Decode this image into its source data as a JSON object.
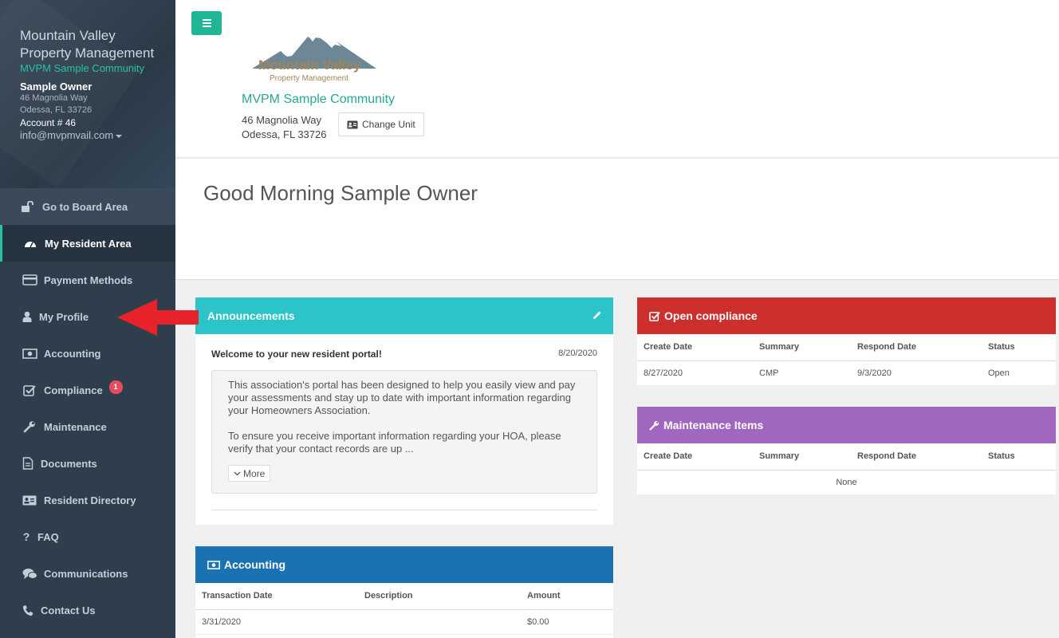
{
  "sidebar": {
    "title": "Mountain Valley Property Management",
    "community": "MVPM Sample Community",
    "owner": "Sample Owner",
    "address_line1": "46 Magnolia Way",
    "address_line2": "Odessa, FL 33726",
    "account": "Account # 46",
    "email": "info@mvpmvail.com",
    "nav": [
      {
        "label": "Go to Board Area",
        "icon": "unlock-icon"
      },
      {
        "label": "My Resident Area",
        "icon": "dashboard-icon"
      },
      {
        "label": "Payment Methods",
        "icon": "credit-card-icon"
      },
      {
        "label": "My Profile",
        "icon": "user-icon"
      },
      {
        "label": "Accounting",
        "icon": "money-icon"
      },
      {
        "label": "Compliance",
        "icon": "check-square-icon",
        "badge": "1"
      },
      {
        "label": "Maintenance",
        "icon": "wrench-icon"
      },
      {
        "label": "Documents",
        "icon": "document-icon"
      },
      {
        "label": "Resident Directory",
        "icon": "address-card-icon"
      },
      {
        "label": "FAQ",
        "icon": "question-icon"
      },
      {
        "label": "Communications",
        "icon": "comments-icon"
      },
      {
        "label": "Contact Us",
        "icon": "phone-icon"
      }
    ]
  },
  "header": {
    "logo_name": "Mountain Valley",
    "logo_sub": "Property Management",
    "community": "MVPM Sample Community",
    "address_line1": "46 Magnolia Way",
    "address_line2": "Odessa, FL 33726",
    "change_unit_label": "Change Unit"
  },
  "greeting": "Good Morning Sample Owner",
  "announcements": {
    "title": "Announcements",
    "item_title": "Welcome to your new resident portal!",
    "item_date": "8/20/2020",
    "para1": "This association's portal has been designed to help you easily view and pay your assessments and stay up to date with important information regarding your Homeowners Association.",
    "para2": "To ensure you receive important information regarding your HOA, please verify that your contact records are up ...",
    "more_label": "More"
  },
  "compliance": {
    "title": "Open compliance",
    "headers": [
      "Create Date",
      "Summary",
      "Respond Date",
      "Status"
    ],
    "rows": [
      [
        "8/27/2020",
        "CMP",
        "9/3/2020",
        "Open"
      ]
    ]
  },
  "maintenance": {
    "title": "Maintenance Items",
    "headers": [
      "Create Date",
      "Summary",
      "Respond Date",
      "Status"
    ],
    "empty": "None"
  },
  "accounting": {
    "title": "Accounting",
    "headers": [
      "Transaction Date",
      "Description",
      "Amount"
    ],
    "rows": [
      [
        "3/31/2020",
        "",
        "$0.00"
      ]
    ]
  },
  "colors": {
    "sidebar_bg": "#2f3e4d",
    "accent": "#27c2a0",
    "announcements": "#2bc4c9",
    "compliance": "#cc2f2c",
    "maintenance": "#a066c0",
    "accounting": "#1b72b2",
    "annotation_arrow": "#e8222a"
  }
}
